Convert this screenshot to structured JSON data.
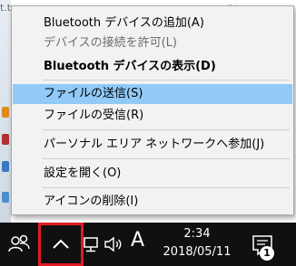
{
  "background": {
    "left_text": "t.tx",
    "right_text": "プト"
  },
  "menu": {
    "items": [
      {
        "label": "Bluetooth デバイスの追加(A)",
        "state": "normal"
      },
      {
        "label": "デバイスの接続を許可(L)",
        "state": "disabled"
      },
      {
        "label": "Bluetooth デバイスの表示(D)",
        "state": "bold"
      },
      {
        "label": "ファイルの送信(S)",
        "state": "highlighted"
      },
      {
        "label": "ファイルの受信(R)",
        "state": "normal"
      },
      {
        "label": "パーソナル エリア ネットワークへ参加(J)",
        "state": "normal"
      },
      {
        "label": "設定を開く(O)",
        "state": "normal"
      },
      {
        "label": "アイコンの削除(I)",
        "state": "normal"
      }
    ],
    "highlight_color": "#91c9f7"
  },
  "taskbar": {
    "ime_label": "A",
    "time": "2:34",
    "date": "2018/05/11",
    "notification_count": "1",
    "icons": [
      "people-icon",
      "chevron-up-icon",
      "network-icon",
      "volume-icon",
      "action-center-icon"
    ],
    "highlight_box_color": "#e21b23"
  }
}
